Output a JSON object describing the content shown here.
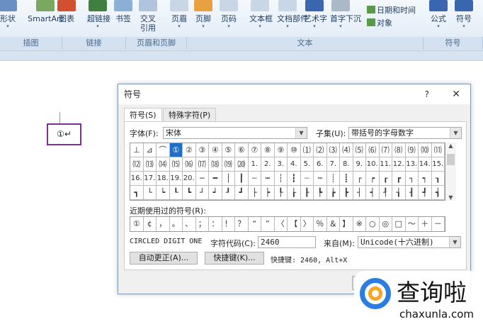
{
  "ribbon": {
    "buttons": [
      {
        "label": "形状",
        "color": "#6a8fc4"
      },
      {
        "label": "SmartArt",
        "color": "#7aa860"
      },
      {
        "label": "图表",
        "color": "#d0502f"
      },
      {
        "label": "超链接",
        "color": "#3f7f3f"
      },
      {
        "label": "书签",
        "color": "#8ab0d8"
      },
      {
        "label": "交叉\n引用",
        "color": "#b0c4de"
      },
      {
        "label": "页眉",
        "color": "#c9d6e6"
      },
      {
        "label": "页脚",
        "color": "#e8a040"
      },
      {
        "label": "页码",
        "color": "#c9d6e6"
      },
      {
        "label": "文本框",
        "color": "#c9d6e6"
      },
      {
        "label": "文档部件",
        "color": "#c9d6e6"
      },
      {
        "label": "艺术字",
        "color": "#3a66b0"
      },
      {
        "label": "首字下沉",
        "color": "#aab8c8"
      },
      {
        "label": "公式",
        "color": "#3a66b0"
      },
      {
        "label": "符号",
        "color": "#3a66b0"
      }
    ],
    "small": [
      {
        "label": "日期和时间"
      },
      {
        "label": "对象"
      }
    ],
    "groups": [
      "插图",
      "链接",
      "页眉和页脚",
      "文本",
      "符号"
    ]
  },
  "document": {
    "selected_text": "①↵"
  },
  "dialog": {
    "title": "符号",
    "help": "?",
    "close": "✕",
    "tabs": [
      "符号(S)",
      "特殊字符(P)"
    ],
    "font_label": "字体(F):",
    "font_value": "宋体",
    "subset_label": "子集(U):",
    "subset_value": "带括号的字母数字",
    "symbols": [
      "⊥",
      "⊿",
      "⌒",
      "①",
      "②",
      "③",
      "④",
      "⑤",
      "⑥",
      "⑦",
      "⑧",
      "⑨",
      "⑩",
      "⑴",
      "⑵",
      "⑶",
      "⑷",
      "⑸",
      "⑹",
      "⑺",
      "⑻",
      "⑼",
      "⑽",
      "⑾",
      "⑿",
      "⒀",
      "⒁",
      "⒂",
      "⒃",
      "⒄",
      "⒅",
      "⒆",
      "⒇",
      "1.",
      "2.",
      "3.",
      "4.",
      "5.",
      "6.",
      "7.",
      "8.",
      "9.",
      "10.",
      "11.",
      "12.",
      "13.",
      "14.",
      "15.",
      "16.",
      "17.",
      "18.",
      "19.",
      "20.",
      "─",
      "━",
      "│",
      "┃",
      "┄",
      "┅",
      "┆",
      "┇",
      "┈",
      "┉",
      "┊",
      "┋",
      "┌",
      "┍",
      "┎",
      "┏",
      "┐",
      "┑",
      "┒",
      "┓",
      "└",
      "┕",
      "┖",
      "┗",
      "┘",
      "┙",
      "┚",
      "┛",
      "├",
      "┝",
      "┞",
      "┟",
      "┠",
      "┡",
      "┢",
      "┣",
      "┤",
      "┥",
      "┦",
      "┧",
      "┨",
      "┩",
      "┪"
    ],
    "selected_symbol": "①",
    "recent_label": "近期使用过的符号(R):",
    "recent": [
      "①",
      "¢",
      "，",
      "。",
      "、",
      "；",
      "：",
      "！",
      "？",
      "“",
      "”",
      "〈",
      "【",
      "〉",
      "％",
      "＆",
      "】",
      "※",
      "○",
      "◎",
      "□",
      "～",
      "＋",
      "－"
    ],
    "char_name": "CIRCLED DIGIT ONE",
    "code_label": "字符代码(C):",
    "code_value": "2460",
    "from_label": "来自(M):",
    "from_value": "Unicode(十六进制)",
    "autocorrect": "自动更正(A)...",
    "shortcut_btn": "快捷键(K)...",
    "shortcut_text": "快捷键: 2460, Alt+X",
    "accent": "#1c6fc4"
  },
  "watermark": {
    "cn": "查询啦",
    "en": "chaxunla.com"
  }
}
